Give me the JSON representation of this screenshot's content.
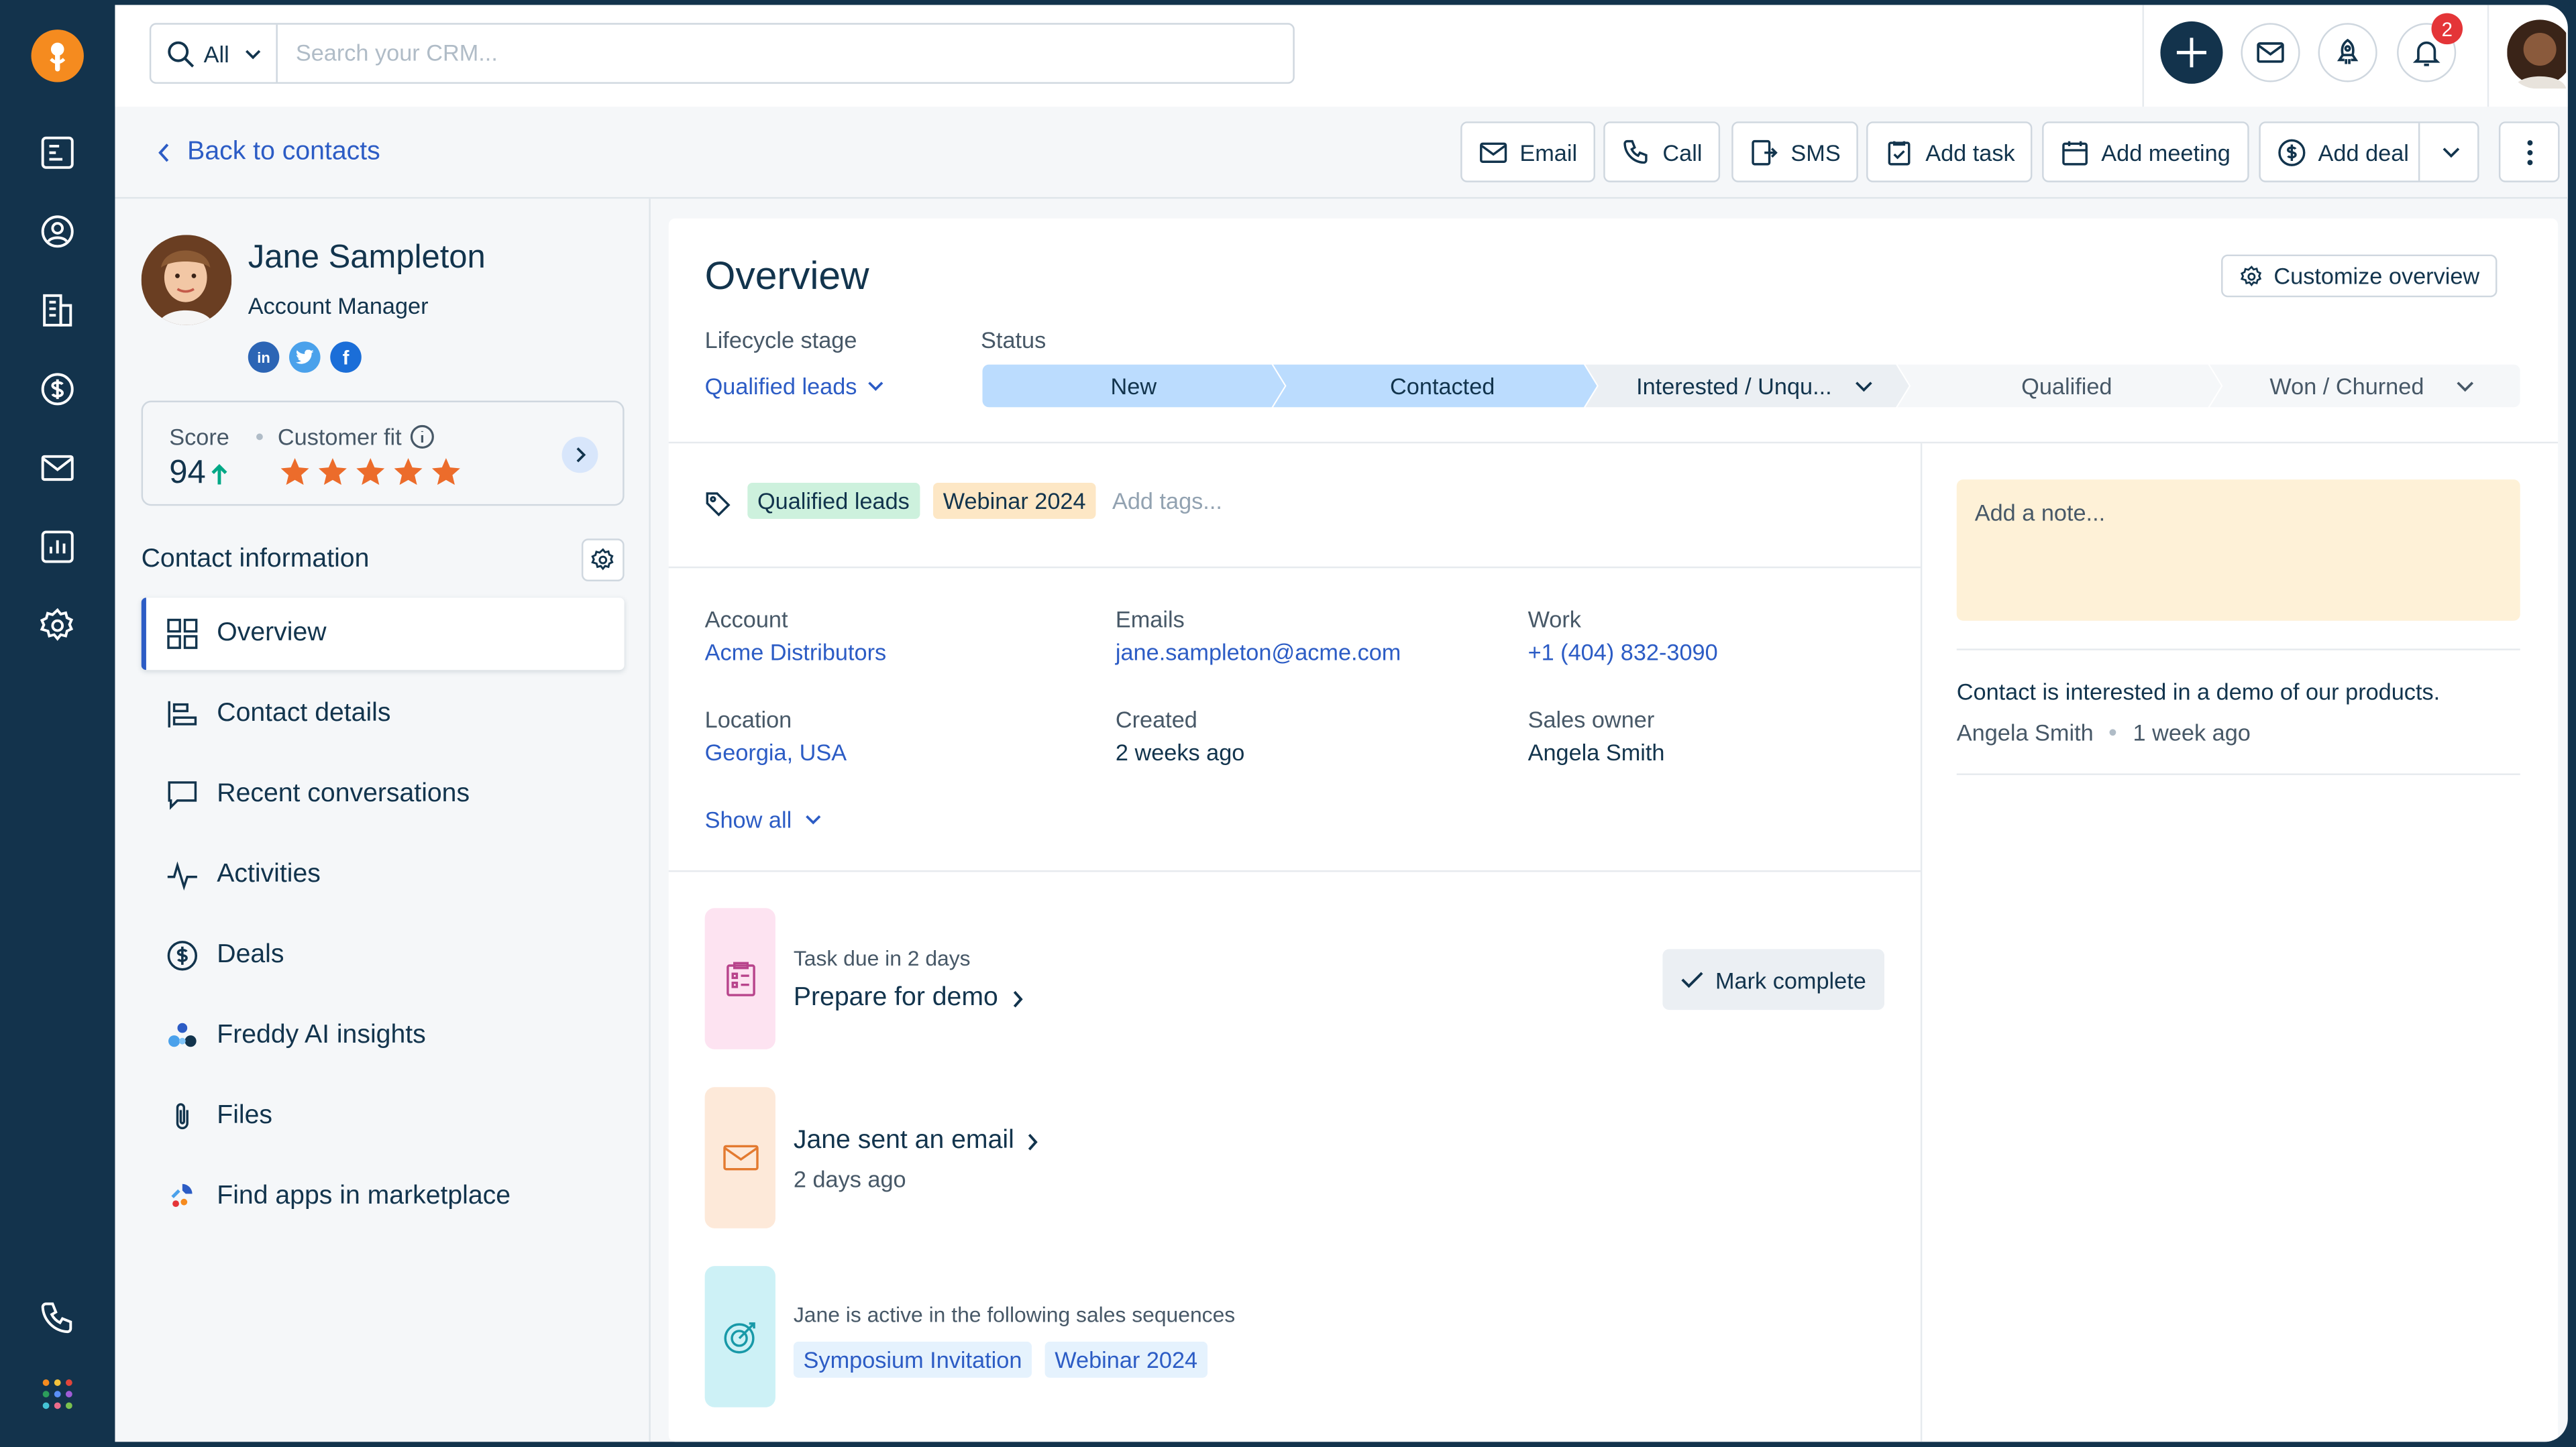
{
  "search": {
    "scope": "All",
    "placeholder": "Search your CRM..."
  },
  "notifications": {
    "count": "2"
  },
  "actions": {
    "back": "Back to contacts",
    "email": "Email",
    "call": "Call",
    "sms": "SMS",
    "add_task": "Add task",
    "add_meeting": "Add meeting",
    "add_deal": "Add deal"
  },
  "contact": {
    "name": "Jane Sampleton",
    "role": "Account Manager",
    "score_label": "Score",
    "score": "94",
    "fit_label": "Customer fit",
    "stars": 5
  },
  "contact_info": {
    "title": "Contact information"
  },
  "nav": [
    {
      "label": "Overview"
    },
    {
      "label": "Contact details"
    },
    {
      "label": "Recent conversations"
    },
    {
      "label": "Activities"
    },
    {
      "label": "Deals"
    },
    {
      "label": "Freddy AI insights"
    },
    {
      "label": "Files"
    },
    {
      "label": "Find apps in marketplace"
    }
  ],
  "overview": {
    "title": "Overview",
    "customize": "Customize overview",
    "lifecycle_label": "Lifecycle stage",
    "lifecycle_value": "Qualified leads",
    "status_label": "Status",
    "pipeline": [
      "New",
      "Contacted",
      "Interested / Unqu...",
      "Qualified",
      "Won / Churned"
    ],
    "tags": [
      "Qualified leads",
      "Webinar 2024"
    ],
    "add_tags": "Add tags...",
    "fields": {
      "account_label": "Account",
      "account": "Acme Distributors",
      "emails_label": "Emails",
      "emails": "jane.sampleton@acme.com",
      "work_label": "Work",
      "work": "+1 (404) 832-3090",
      "location_label": "Location",
      "location": "Georgia, USA",
      "created_label": "Created",
      "created": "2 weeks ago",
      "owner_label": "Sales owner",
      "owner": "Angela Smith"
    },
    "show_all": "Show all",
    "task": {
      "due": "Task due in 2 days",
      "title": "Prepare for demo",
      "mark": "Mark complete"
    },
    "email_activity": {
      "title": "Jane sent an email",
      "time": "2 days ago"
    },
    "sequences": {
      "text": "Jane is active in the following sales sequences",
      "items": [
        "Symposium Invitation",
        "Webinar 2024"
      ]
    },
    "note": {
      "placeholder": "Add a note...",
      "text": "Contact is interested in a demo of our products.",
      "author": "Angela Smith",
      "time": "1 week ago"
    }
  },
  "colors": {
    "accent": "#2c5cc5",
    "rail": "#13334c",
    "logo": "#f58b1f",
    "pipeline_done": "#bbdcfe",
    "note": "#fef1d7",
    "star": "#ec6c2b"
  }
}
